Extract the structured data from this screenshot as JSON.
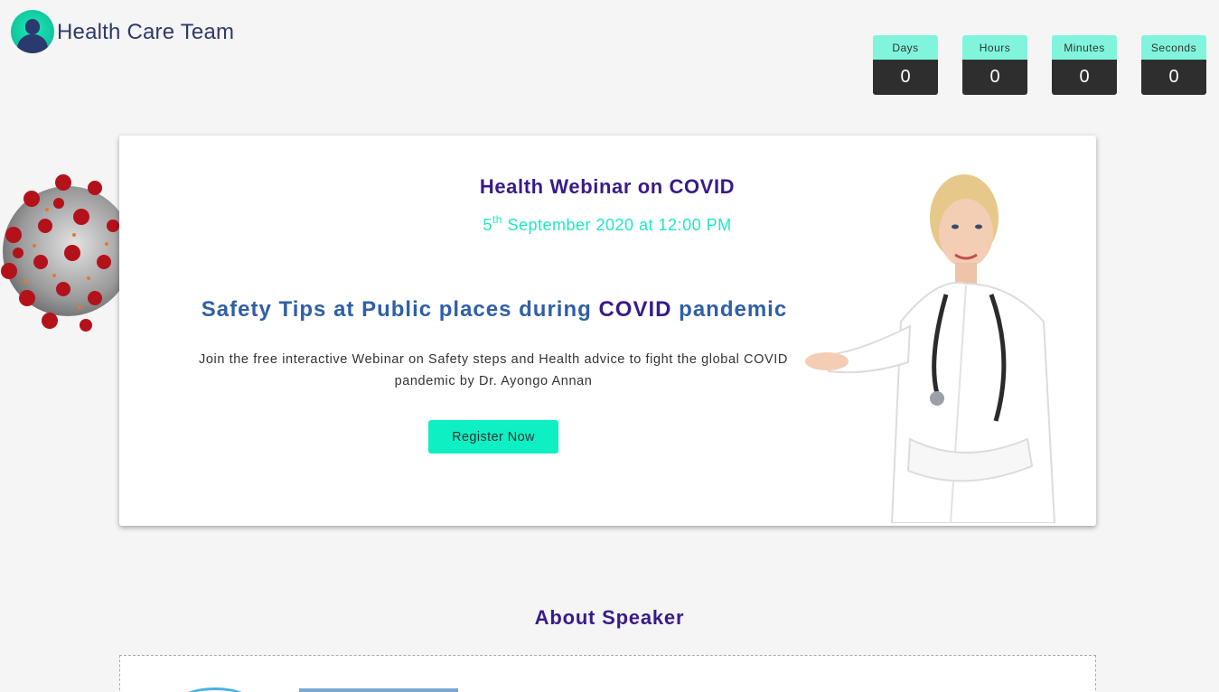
{
  "brand": {
    "name": "Health Care Team"
  },
  "countdown": [
    {
      "label": "Days",
      "value": "0"
    },
    {
      "label": "Hours",
      "value": "0"
    },
    {
      "label": "Minutes",
      "value": "0"
    },
    {
      "label": "Seconds",
      "value": "0"
    }
  ],
  "hero": {
    "title": "Health Webinar on COVID",
    "date_day": "5",
    "date_suffix": "th",
    "date_rest": " September 2020 at 12:00 PM",
    "subtitle_pre": "Safety Tips at Public places during ",
    "subtitle_em": "COVID",
    "subtitle_post": " pandemic",
    "description": "Join the free interactive Webinar on Safety steps and Health advice to fight the global COVID pandemic by Dr. Ayongo Annan",
    "register_label": "Register Now"
  },
  "about": {
    "title": "About Speaker"
  },
  "colors": {
    "accent_teal": "#0ef0c4",
    "heading_purple": "#3a1a8a",
    "subtitle_blue": "#2f5fa8",
    "countdown_dark": "#2e2e2e"
  }
}
